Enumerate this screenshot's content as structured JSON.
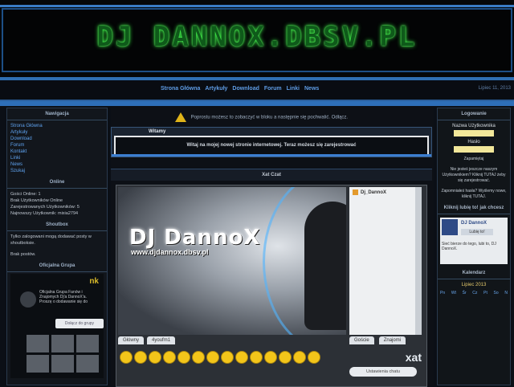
{
  "site": {
    "banner_title": "DJ DANNOX.DBSV.PL"
  },
  "nav": {
    "links": [
      "Strona Główna",
      "Artykuły",
      "Download",
      "Forum",
      "Linki",
      "News"
    ],
    "date": "Lipiec 11, 2013"
  },
  "left": {
    "nav_header": "Nawigacja",
    "nav_items": [
      "Strona Główna",
      "Artykuły",
      "Download",
      "Forum",
      "Kontakt",
      "Linki",
      "News",
      "Szukaj"
    ],
    "online_header": "Online",
    "online_text": [
      "Gości Online: 1",
      "Brak Użytkowników Online",
      "Zarejestrowanych Użytkowników: 5",
      "Najnowszy Użytkownik: mixia2794"
    ],
    "shoutbox_header": "Shoutbox",
    "shoutbox_text": "Tylko zalogowani mogą dodawać posty w shoutboksie.",
    "shoutbox_empty": "Brak postów.",
    "group_header": "Oficjalna Grupa",
    "group_text": "Oficjalna Grupa Fanów i Znajomych Dj'a DannoX'a. Proszę o dodawanie się do",
    "group_join": "Dołącz do grupy",
    "nk": "nk"
  },
  "center": {
    "alert": "Poprostu możesz to zobaczyć w bloku a następnie się pochwalić. Odłącz.",
    "welcome_title": "Witamy",
    "welcome_text": "Witaj na mojej nowej stronie internetowej. Teraz możesz się zarejestrować",
    "chat_header": "Xat Czat",
    "dj_logo": "DJ DannoX",
    "dj_url": "www.djdannox.dbsv.pl",
    "user": "Dj_DannoX",
    "tab_main": "Główny",
    "tab_you": "4youfm1",
    "tab_guests": "Goście",
    "tab_friends": "Znajomi",
    "xat_logo": "xat",
    "chat_settings": "Ustawienia chatu"
  },
  "right": {
    "login_header": "Logowanie",
    "username_label": "Nazwa Użytkownika",
    "password_label": "Hasło",
    "remember": "Zapamiętaj",
    "register_text": "Nie jesteś jeszcze naszym Użytkownikiem? Kliknij TUTAJ żeby się zarejestrować.",
    "forgot_text": "Zapomniałeś hasła? Wyślemy nowe, kliknij TUTAJ.",
    "fb_header": "Kliknij lubię to! jak chcesz",
    "fb_name": "DJ DannoX",
    "fb_sub": "Facebook",
    "fb_like": "Lubię to!",
    "fb_text": "Sieć bierze do tego, lubi to, DJ DannoX.",
    "calendar_header": "Kalendarz",
    "calendar_month": "Lipiec 2013",
    "days": [
      "Pn",
      "Wt",
      "Śr",
      "Cz",
      "Pt",
      "So",
      "N"
    ]
  }
}
